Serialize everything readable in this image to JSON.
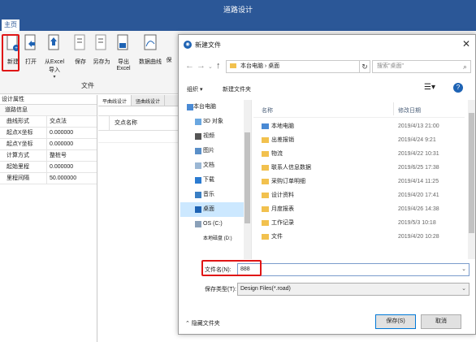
{
  "app": {
    "title": "道路设计",
    "tab_home": "主页"
  },
  "ribbon": {
    "buttons": [
      {
        "label": "新建"
      },
      {
        "label": "打开"
      },
      {
        "label": "从Excel导入"
      },
      {
        "label": "保存"
      },
      {
        "label": "另存为"
      },
      {
        "label": "导出Excel"
      },
      {
        "label": "数据曲线"
      },
      {
        "label": "保"
      }
    ],
    "group_label": "文件"
  },
  "leftpanel": {
    "title": "设计属性",
    "header": "道路信息",
    "rows": [
      {
        "key": "曲线形式",
        "value": "交点法"
      },
      {
        "key": "起点X坐标",
        "value": "0.000000"
      },
      {
        "key": "起点Y坐标",
        "value": "0.000000"
      },
      {
        "key": "计算方式",
        "value": "整桩号"
      },
      {
        "key": "起始里程",
        "value": "0.000000"
      },
      {
        "key": "里程间隔",
        "value": "50.000000"
      }
    ]
  },
  "center": {
    "tabs": [
      "平曲线设计",
      "竖曲线设计"
    ],
    "grid_header": "交点名称"
  },
  "dialog": {
    "title": "新建文件",
    "address": [
      "本台电脑",
      "桌面"
    ],
    "search_placeholder": "搜索\"桌面\"",
    "organize": "组织 ▾",
    "new_folder": "新建文件夹",
    "nav": [
      {
        "label": "本台电脑",
        "icon": "computer-icon"
      },
      {
        "label": "3D 对象",
        "icon": "cube-icon"
      },
      {
        "label": "视频",
        "icon": "video-icon"
      },
      {
        "label": "图片",
        "icon": "picture-icon"
      },
      {
        "label": "文档",
        "icon": "document-icon"
      },
      {
        "label": "下载",
        "icon": "download-icon"
      },
      {
        "label": "音乐",
        "icon": "music-icon"
      },
      {
        "label": "桌面",
        "icon": "desktop-icon"
      },
      {
        "label": "OS (C:)",
        "icon": "drive-icon"
      },
      {
        "label": "本地磁盘 (D:)",
        "icon": "drive-icon"
      }
    ],
    "columns": {
      "name": "名称",
      "date": "修改日期"
    },
    "files": [
      {
        "name": "本地电脑",
        "date": "2019/4/13 21:00"
      },
      {
        "name": "出差报销",
        "date": "2019/4/24 9:21"
      },
      {
        "name": "物流",
        "date": "2019/4/22 10:31"
      },
      {
        "name": "联系人信息数据",
        "date": "2019/6/25 17:38"
      },
      {
        "name": "采购订单明细",
        "date": "2019/4/14 11:25"
      },
      {
        "name": "设计资料",
        "date": "2019/4/20 17:41"
      },
      {
        "name": "月度报表",
        "date": "2019/4/26 14:38"
      },
      {
        "name": "工作记录",
        "date": "2019/5/3 10:18"
      },
      {
        "name": "文件",
        "date": "2019/4/20 10:28"
      }
    ],
    "filename_label": "文件名(N):",
    "filename_value": "888",
    "filetype_label": "保存类型(T):",
    "filetype_value": "Design Files(*.road)",
    "hide_folders": "隐藏文件夹",
    "save": "保存(S)",
    "cancel": "取消"
  },
  "colors": {
    "titlebar": "#2b5797",
    "highlight": "#e01515",
    "selected": "#cce8ff"
  }
}
